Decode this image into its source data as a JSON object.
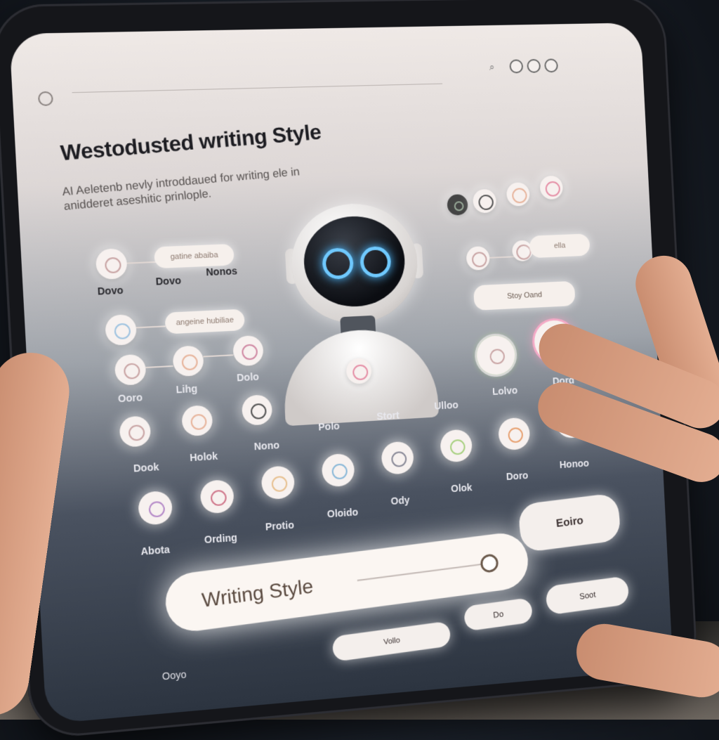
{
  "header": {
    "title": "Westodusted writing Style",
    "subtitle": "AI Aeletenb nevly introddaued for writing ele in anidderet aseshitic prinlople."
  },
  "nodes": {
    "row1": [
      {
        "label": "Dovo",
        "pill": "gatine abaiba"
      },
      {
        "label": "Dovo"
      },
      {
        "label": "Nonos"
      }
    ],
    "row2": [
      {
        "pill": "angeine hubiliae"
      }
    ],
    "row3": [
      {
        "label": "Ooro"
      },
      {
        "label": "Lihg"
      },
      {
        "label": "Dolo"
      }
    ],
    "row4": [
      {
        "label": "Dook"
      },
      {
        "label": "Holok"
      },
      {
        "label": "Nono"
      }
    ],
    "row5": [
      {
        "label": "Abota"
      },
      {
        "label": "Ording"
      },
      {
        "label": "Protio"
      },
      {
        "label": "Oloido"
      },
      {
        "label": "Ody"
      },
      {
        "label": "Olok"
      },
      {
        "label": "Doro"
      },
      {
        "label": "Honoo"
      }
    ],
    "right": {
      "pill1": "ella",
      "pill2": "Stoy Oand",
      "labels": [
        "Lolvo",
        "Dord"
      ]
    },
    "mid_labels": [
      "Polo",
      "Stort",
      "Ulloo"
    ]
  },
  "slider": {
    "label": "Writing Style",
    "value": 0.92
  },
  "buttons": {
    "big": "Eoiro",
    "b1": "Vollo",
    "b2": "Do",
    "b3": "Soot"
  },
  "footer": {
    "text": "Ooyo"
  }
}
